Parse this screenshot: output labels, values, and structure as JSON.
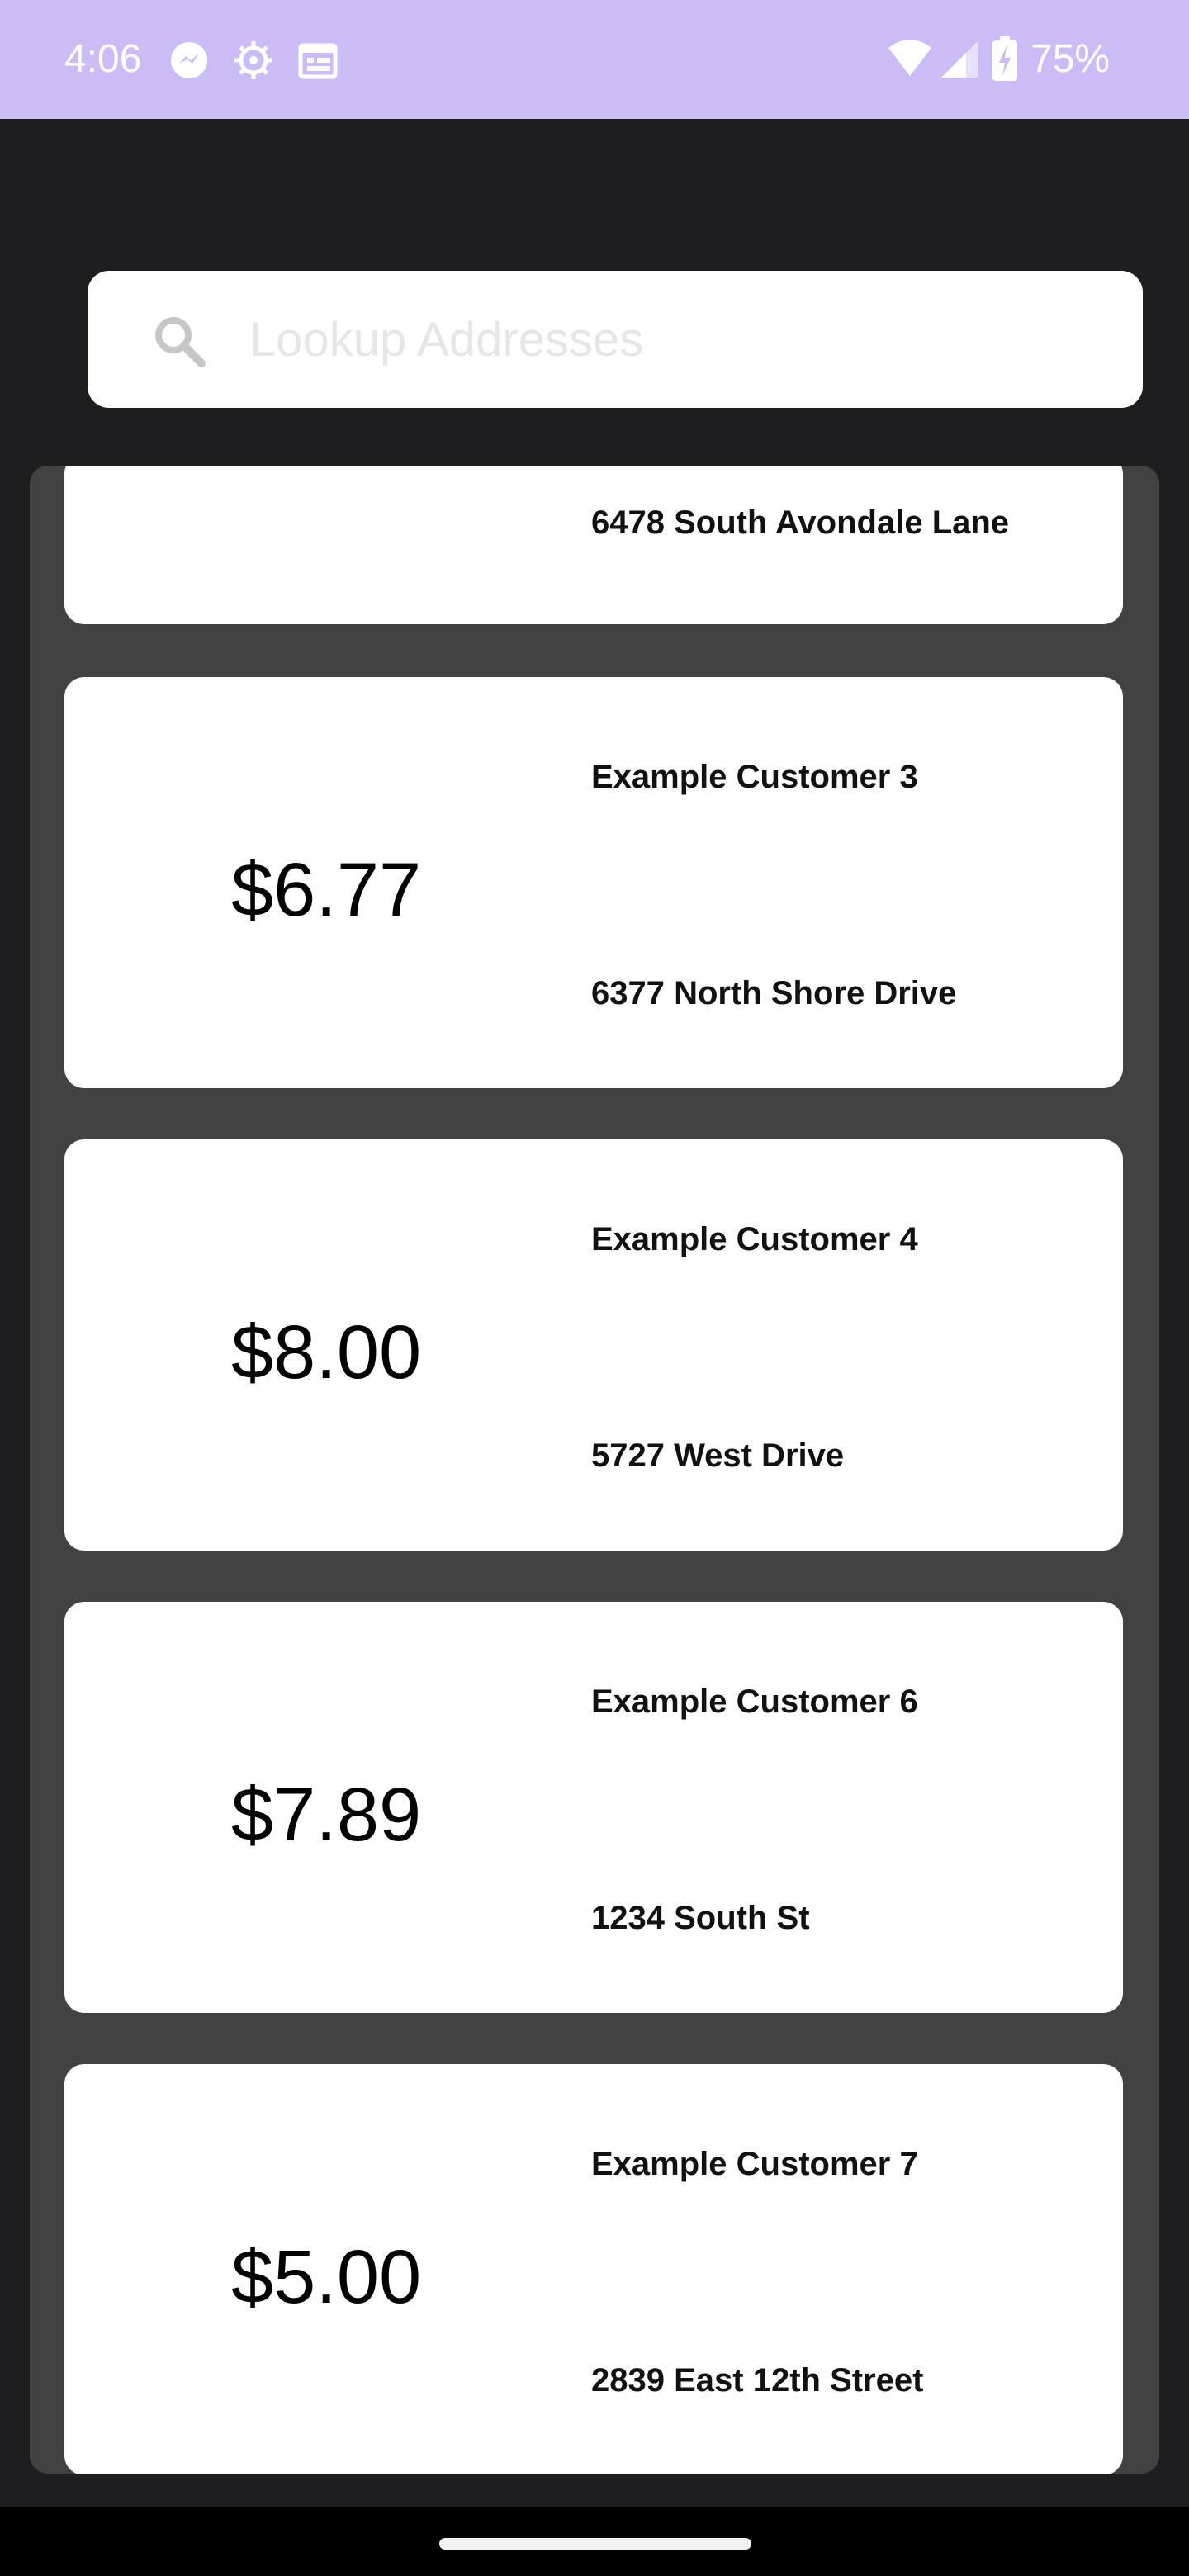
{
  "status_bar": {
    "time": "4:06",
    "battery": "75%",
    "icons": [
      "messenger-icon",
      "settings-gear-icon",
      "calendar-icon",
      "wifi-icon",
      "signal-icon",
      "battery-charging-icon"
    ]
  },
  "search": {
    "placeholder": "Lookup Addresses",
    "value": "",
    "icon": "search-icon"
  },
  "list": {
    "items": [
      {
        "amount": "",
        "customer": "",
        "address": "6478 South Avondale Lane"
      },
      {
        "amount": "$6.77",
        "customer": "Example Customer 3",
        "address": "6377 North Shore Drive"
      },
      {
        "amount": "$8.00",
        "customer": "Example Customer 4",
        "address": "5727 West Drive"
      },
      {
        "amount": "$7.89",
        "customer": "Example Customer 6",
        "address": "1234 South St"
      },
      {
        "amount": "$5.00",
        "customer": "Example Customer 7",
        "address": "2839 East 12th Street"
      }
    ]
  },
  "colors": {
    "status_bar_bg": "#cbbcf6",
    "app_bg": "#1e1d22",
    "panel_bg": "#424242",
    "card_bg": "#ffffff"
  }
}
